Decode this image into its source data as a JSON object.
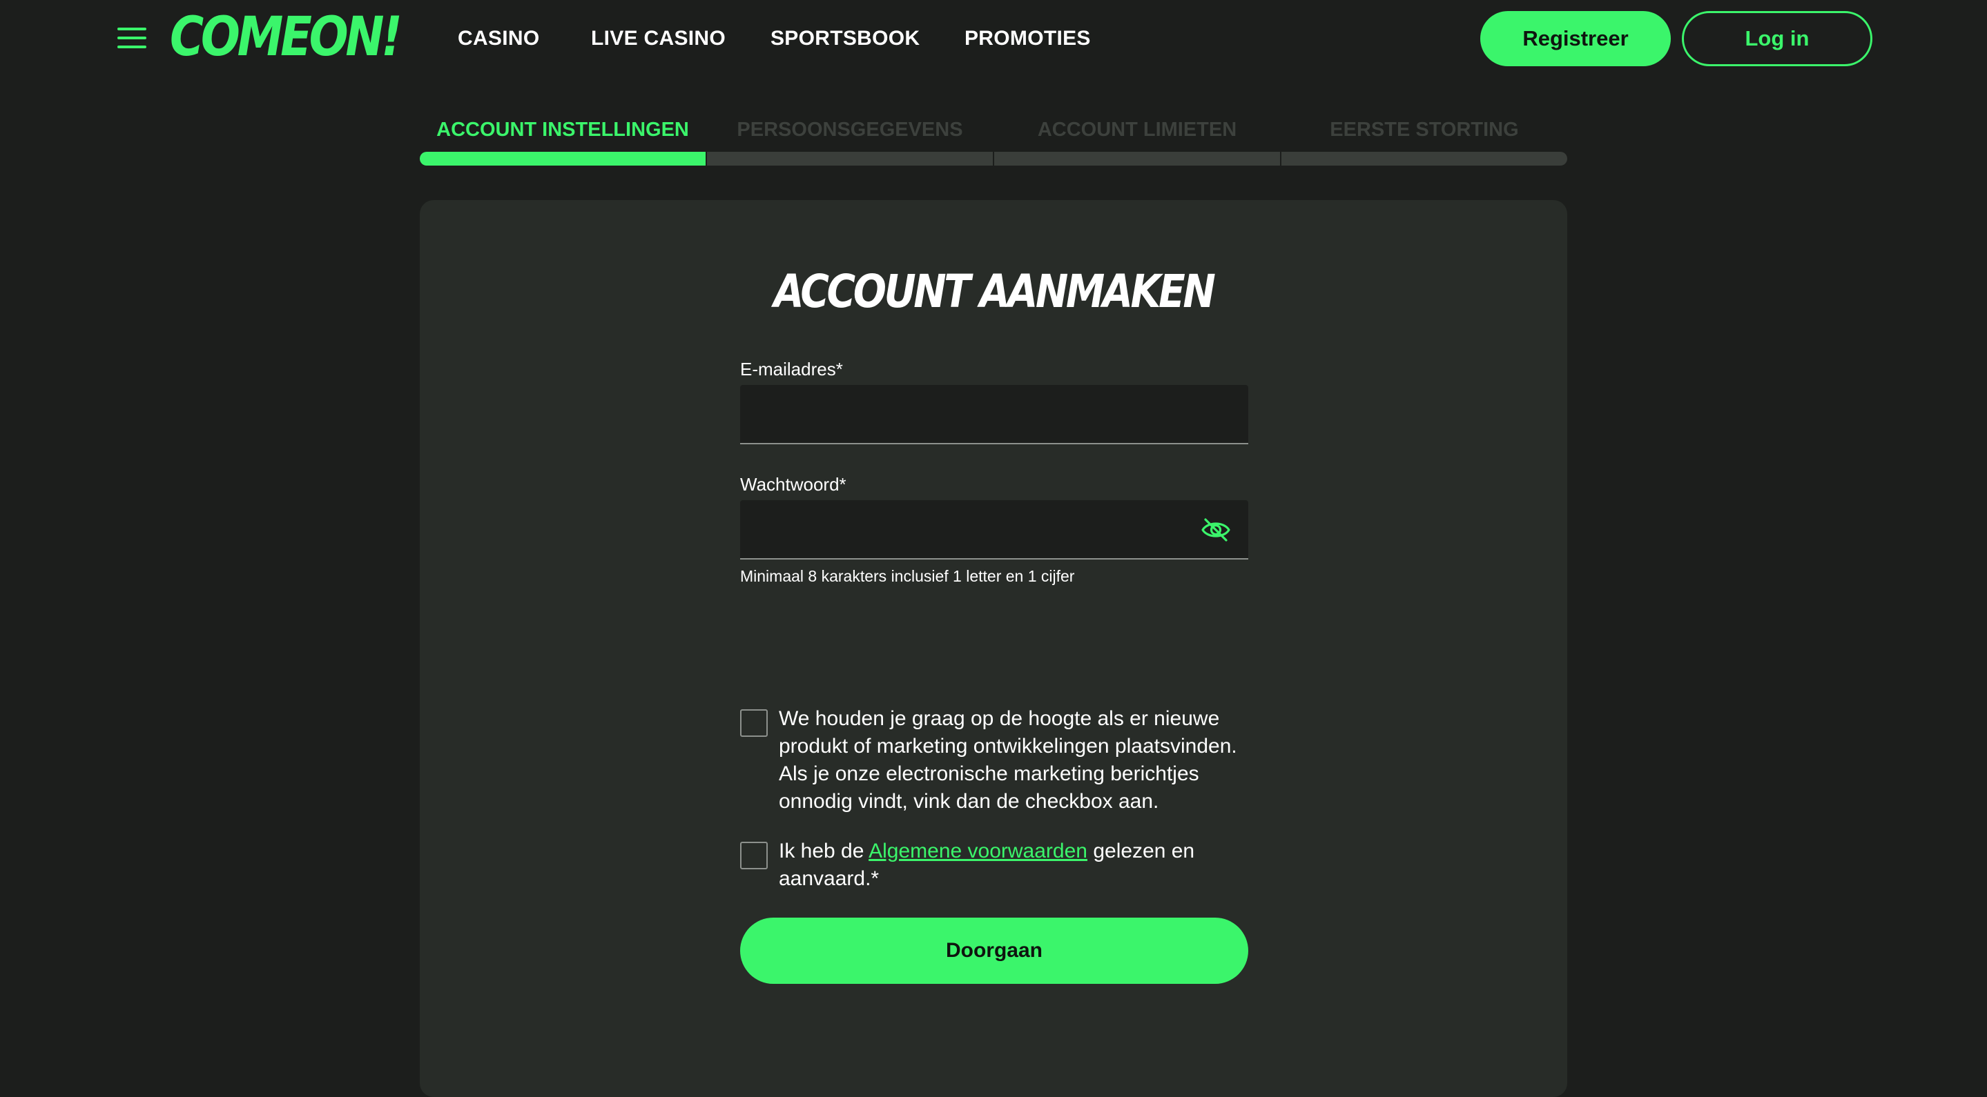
{
  "header": {
    "logo": "COMEON!",
    "menu_icon": "hamburger-menu-icon",
    "nav": [
      {
        "label": "CASINO"
      },
      {
        "label": "LIVE CASINO"
      },
      {
        "label": "SPORTSBOOK"
      },
      {
        "label": "PROMOTIES"
      }
    ],
    "register_label": "Registreer",
    "login_label": "Log in"
  },
  "steps": [
    {
      "label": "ACCOUNT INSTELLINGEN",
      "active": true
    },
    {
      "label": "PERSOONSGEGEVENS",
      "active": false
    },
    {
      "label": "ACCOUNT LIMIETEN",
      "active": false
    },
    {
      "label": "EERSTE STORTING",
      "active": false
    }
  ],
  "form": {
    "title": "ACCOUNT AANMAKEN",
    "email": {
      "label": "E-mailadres*",
      "value": ""
    },
    "password": {
      "label": "Wachtwoord*",
      "value": "",
      "toggle_icon": "eye-slash-icon"
    },
    "password_hint": "Minimaal 8 karakters inclusief 1 letter en 1 cijfer",
    "marketing_checkbox": {
      "checked": false,
      "text": "We houden je graag op de hoogte als er nieuwe produkt of marketing ontwikkelingen plaatsvinden. Als je onze electronische marketing berichtjes onnodig vindt, vink dan de checkbox aan."
    },
    "terms_checkbox": {
      "checked": false,
      "prefix": "Ik heb de ",
      "link": "Algemene voorwaarden",
      "suffix": " gelezen en aanvaard.*"
    },
    "submit_label": "Doorgaan"
  },
  "colors": {
    "accent": "#3bf56b",
    "background": "#1c1e1c",
    "card": "#282c28",
    "inactive_step": "#3d413d"
  }
}
